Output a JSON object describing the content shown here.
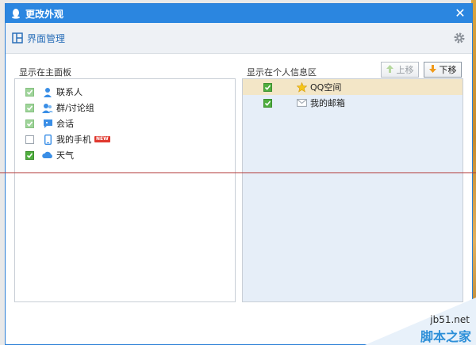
{
  "window": {
    "title": "更改外观",
    "close_glyph": "✕"
  },
  "toolbar": {
    "title": "界面管理"
  },
  "left_panel": {
    "label": "显示在主面板",
    "items": [
      {
        "label": "联系人",
        "icon": "person-icon",
        "checked": true
      },
      {
        "label": "群/讨论组",
        "icon": "group-icon",
        "checked": true
      },
      {
        "label": "会话",
        "icon": "chat-icon",
        "checked": true
      },
      {
        "label": "我的手机",
        "icon": "phone-icon",
        "checked": false,
        "badge": "NEW"
      },
      {
        "label": "天气",
        "icon": "cloud-icon",
        "checked": true
      }
    ]
  },
  "right_panel": {
    "label": "显示在个人信息区",
    "move_up_label": "上移",
    "move_down_label": "下移",
    "items": [
      {
        "label": "QQ空间",
        "icon": "star-icon",
        "checked": true
      },
      {
        "label": "我的邮箱",
        "icon": "mail-icon",
        "checked": true
      }
    ]
  },
  "watermark": {
    "line1": "jb51.net",
    "line2": "脚本之家"
  },
  "colors": {
    "titlebar": "#2b86e0",
    "checkbox_green": "#4fae3e",
    "selected_row": "#f3e6c7",
    "link_blue": "#2a6fb9"
  }
}
